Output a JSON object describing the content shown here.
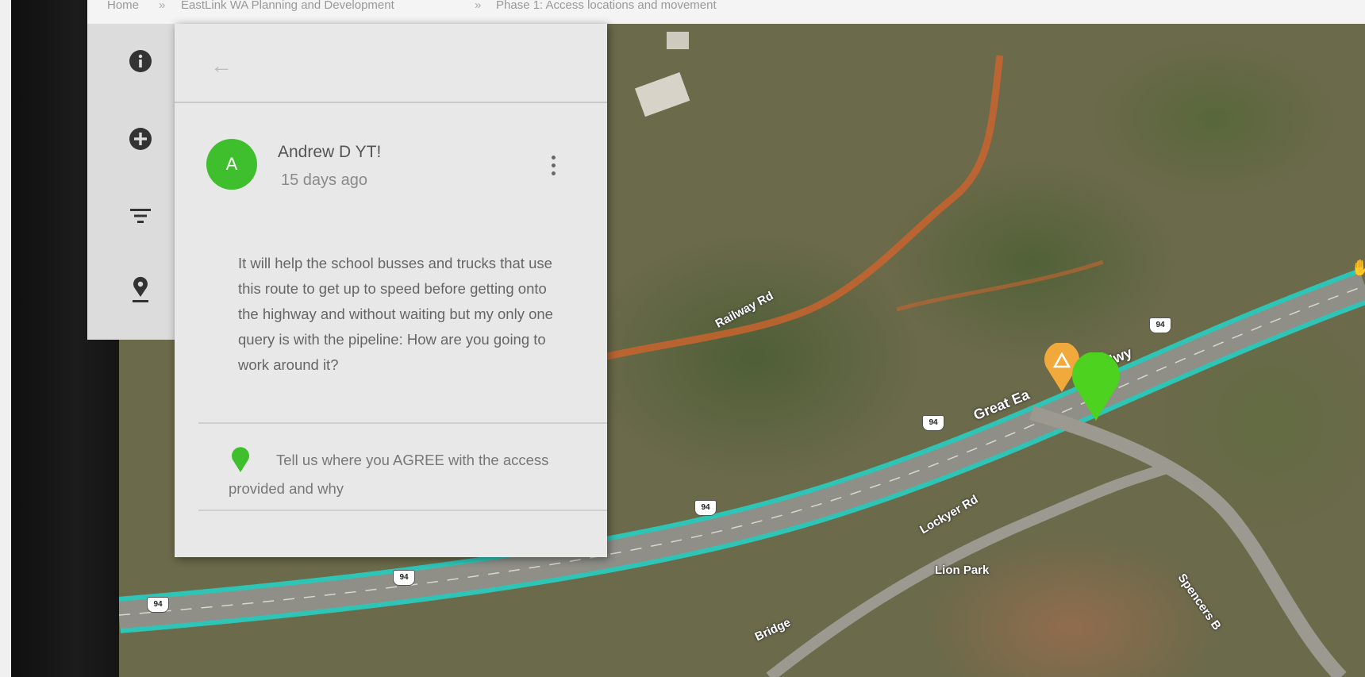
{
  "breadcrumb": [
    {
      "label": "Home"
    },
    {
      "label": "EastLink WA Planning and Development"
    },
    {
      "label": "Phase 1: Access locations and movement"
    }
  ],
  "breadcrumb_separator": "»",
  "tool_rail": {
    "items": [
      {
        "icon": "info-icon"
      },
      {
        "icon": "add-icon"
      },
      {
        "icon": "filter-icon"
      },
      {
        "icon": "location-pin-icon"
      }
    ]
  },
  "comment": {
    "back_icon": "←",
    "avatar_initial": "A",
    "author": "Andrew D YT!",
    "date": "15 days ago",
    "body": "It will help the school busses and trucks that use this route to get up to speed before getting onto the highway and without waiting but my only one query is with the pipeline: How are you going to work around it?",
    "question": "Tell us where you AGREE with the access provided and why"
  },
  "map": {
    "labels": {
      "railway": "Railway Rd",
      "highway": "Great Ea",
      "highway_end": "Hwy",
      "lockyer": "Lockyer Rd",
      "lion_park": "Lion Park",
      "spencers": "Spencers B",
      "bridge": "Bridge"
    },
    "route_number": "94",
    "colors": {
      "highway_highlight": "#2ec4b6",
      "dirt_road": "#c8642e",
      "marker_agree": "#4cd21f",
      "marker_warning": "#f2a93b"
    }
  }
}
